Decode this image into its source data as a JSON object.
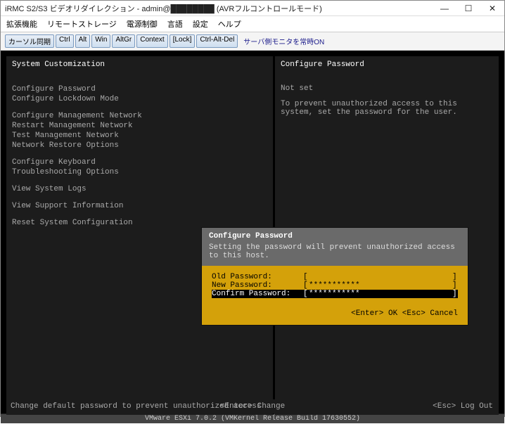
{
  "window": {
    "title": "iRMC S2/S3 ビデオリダイレクション - admin@████████ (AVRフルコントロールモード)"
  },
  "menubar": [
    "拡張機能",
    "リモートストレージ",
    "電源制御",
    "言語",
    "設定",
    "ヘルプ"
  ],
  "toolbar": {
    "buttons": [
      "カーソル同期",
      "Ctrl",
      "Alt",
      "Win",
      "AltGr",
      "Context",
      "[Lock]",
      "Ctrl-Alt-Del"
    ],
    "note": "サーバ側モニタを常時ON"
  },
  "left": {
    "title": "System Customization",
    "items": [
      "Configure Password",
      "Configure Lockdown Mode",
      "",
      "Configure Management Network",
      "Restart Management Network",
      "Test Management Network",
      "Network Restore Options",
      "",
      "Configure Keyboard",
      "Troubleshooting Options",
      "",
      "View System Logs",
      "",
      "View Support Information",
      "",
      "Reset System Configuration"
    ]
  },
  "right": {
    "title": "Configure Password",
    "status": "Not set",
    "desc": "To prevent unauthorized access to this system, set the password for the user."
  },
  "footer": {
    "left": "Change default password to prevent unauthorized access",
    "center": "<Enter> Change",
    "right": "<Esc> Log Out"
  },
  "dialog": {
    "title": "Configure Password",
    "desc": "Setting the password will prevent unauthorized access to this host.",
    "fields": {
      "old_label": "Old Password:",
      "old_value": "",
      "new_label": "New Password:",
      "new_value": "***********",
      "confirm_label": "Confirm Password:",
      "confirm_value": "***********"
    },
    "actions": "<Enter> OK  <Esc> Cancel"
  },
  "version": "VMware ESXi 7.0.2 (VMKernel Release Build 17630552)"
}
